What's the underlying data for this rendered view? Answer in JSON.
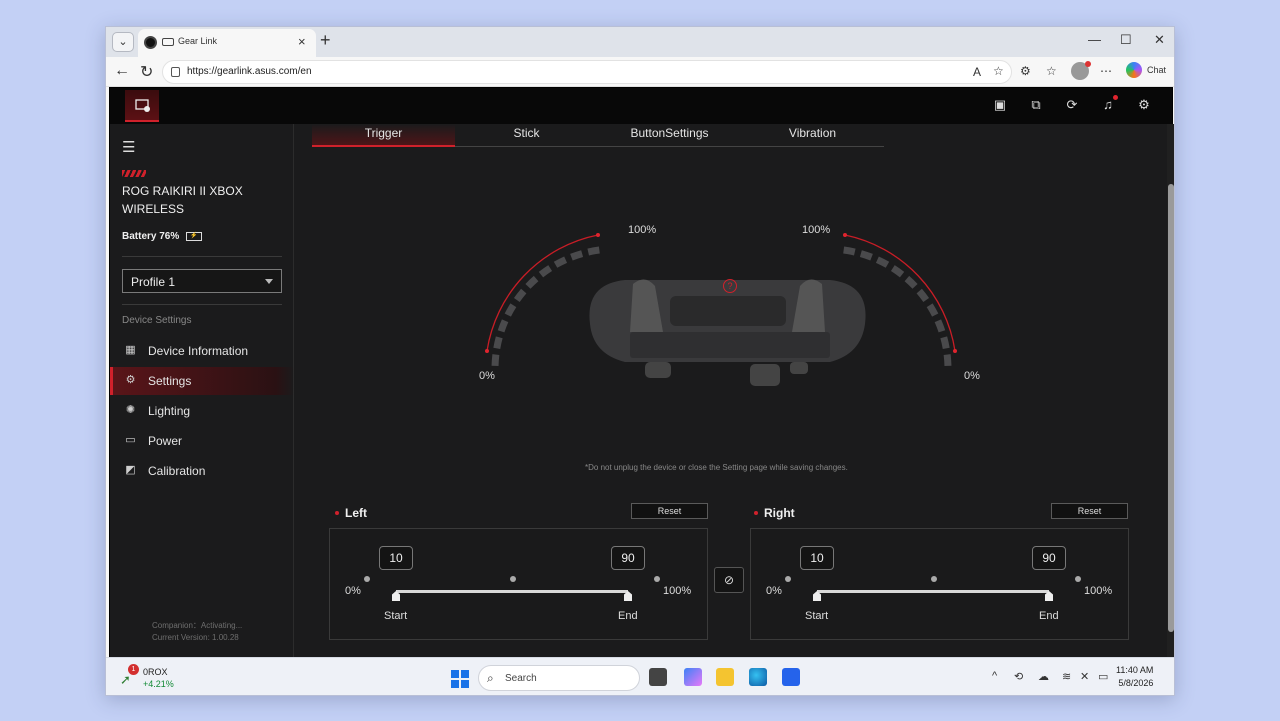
{
  "browser": {
    "tab_title": "Gear Link",
    "url": "https://gearlink.asus.com/en",
    "chat_label": "Chat",
    "new_tab": "+",
    "close_tab": "×",
    "window_buttons": [
      "—",
      "☐",
      "✕"
    ]
  },
  "app": {
    "device_name": "ROG RAIKIRI II XBOX WIRELESS",
    "battery": "Battery 76%",
    "profile": "Profile 1",
    "section_label": "Device Settings",
    "nav": [
      {
        "label": "Device Information",
        "icon": "grid-icon"
      },
      {
        "label": "Settings",
        "icon": "gear-icon"
      },
      {
        "label": "Lighting",
        "icon": "sun-icon"
      },
      {
        "label": "Power",
        "icon": "battery-icon"
      },
      {
        "label": "Calibration",
        "icon": "calibration-icon"
      }
    ],
    "companion": "Companion：Activating...",
    "version": "Current Version: 1.00.28",
    "accent": "#d0212b"
  },
  "tabs": [
    "Trigger",
    "Stick",
    "ButtonSettings",
    "Vibration"
  ],
  "active_tab": "Trigger",
  "gauge": {
    "left_top": "100%",
    "left_bottom": "0%",
    "right_top": "100%",
    "right_bottom": "0%",
    "help": "?"
  },
  "notice": "*Do not unplug the device or close the Setting page while saving changes.",
  "left": {
    "title": "Left",
    "reset": "Reset",
    "start_value": "10",
    "end_value": "90",
    "min_label": "0%",
    "max_label": "100%",
    "start_label": "Start",
    "end_label": "End"
  },
  "right": {
    "title": "Right",
    "reset": "Reset",
    "start_value": "10",
    "end_value": "90",
    "min_label": "0%",
    "max_label": "100%",
    "start_label": "Start",
    "end_label": "End"
  },
  "taskbar": {
    "stock_name": "0ROX",
    "stock_change": "+4.21%",
    "stock_badge": "1",
    "search": "Search",
    "time": "11:40 AM",
    "date": "5/8/2026"
  }
}
